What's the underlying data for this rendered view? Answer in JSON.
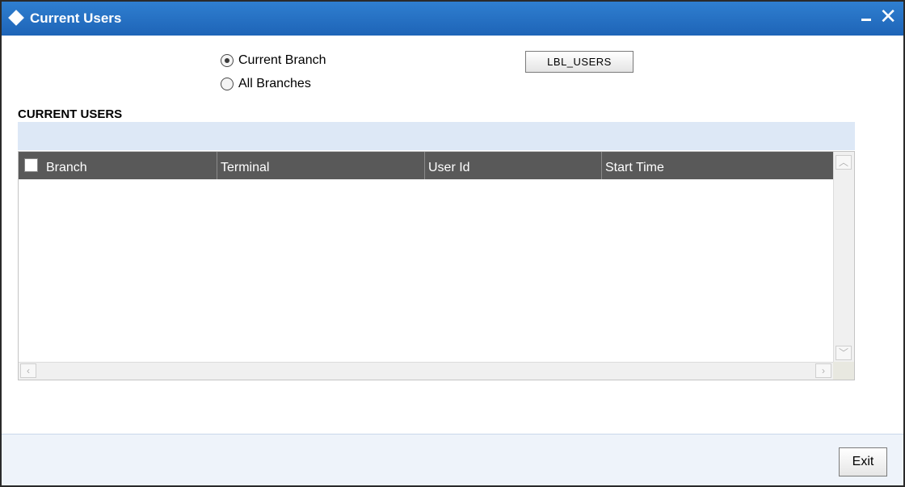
{
  "window": {
    "title": "Current Users",
    "title_icon": "diamond-icon",
    "minimize_icon": "minimize-icon",
    "close_icon": "close-icon",
    "close_glyph": "✕"
  },
  "options": {
    "current_branch_label": "Current Branch",
    "all_branches_label": "All Branches",
    "selected": "Current Branch",
    "lbl_users_button": "LBL_USERS"
  },
  "section": {
    "title": "CURRENT USERS"
  },
  "grid": {
    "columns": [
      "Branch",
      "Terminal",
      "User Id",
      "Start Time"
    ],
    "rows": []
  },
  "footer": {
    "exit_label": "Exit"
  },
  "colors": {
    "titlebar": "#1e64b7",
    "grid_header": "#595959",
    "section_bar": "#dde8f6"
  }
}
